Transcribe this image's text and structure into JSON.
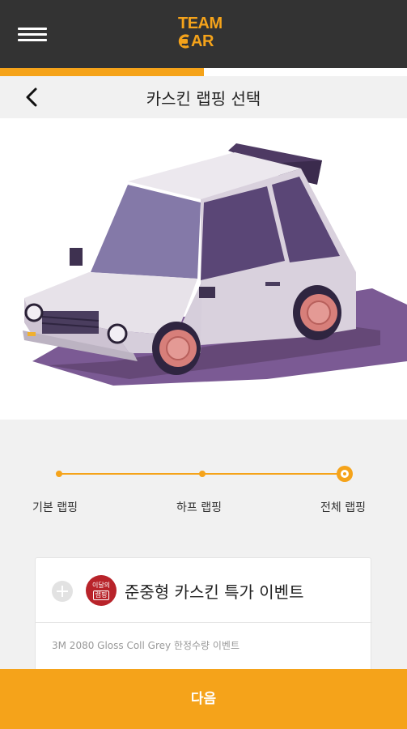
{
  "header": {
    "logo_line1": "TEAM",
    "logo_line2": "AR",
    "menu_icon": "hamburger-menu-icon"
  },
  "progress": {
    "fraction": 0.5
  },
  "titlebar": {
    "back_icon": "chevron-left-icon",
    "title": "카스킨 랩핑 선택"
  },
  "colors": {
    "accent": "#f5a31a",
    "header_bg": "#333333",
    "badge": "#b8232a",
    "car_body": "#e3dde4",
    "shadow": "#7b5a94"
  },
  "stepper": {
    "steps": [
      {
        "label": "기본 랩핑"
      },
      {
        "label": "하프 랩핑"
      },
      {
        "label": "전체 랩핑"
      }
    ],
    "selected_index": 2
  },
  "event_card": {
    "badge_line1": "이달의",
    "badge_line2": "랩핑",
    "title": "준중형 카스킨 특가 이벤트",
    "description": "3M 2080 Gloss Coll Grey 한정수량 이벤트"
  },
  "footer": {
    "next_label": "다음"
  }
}
